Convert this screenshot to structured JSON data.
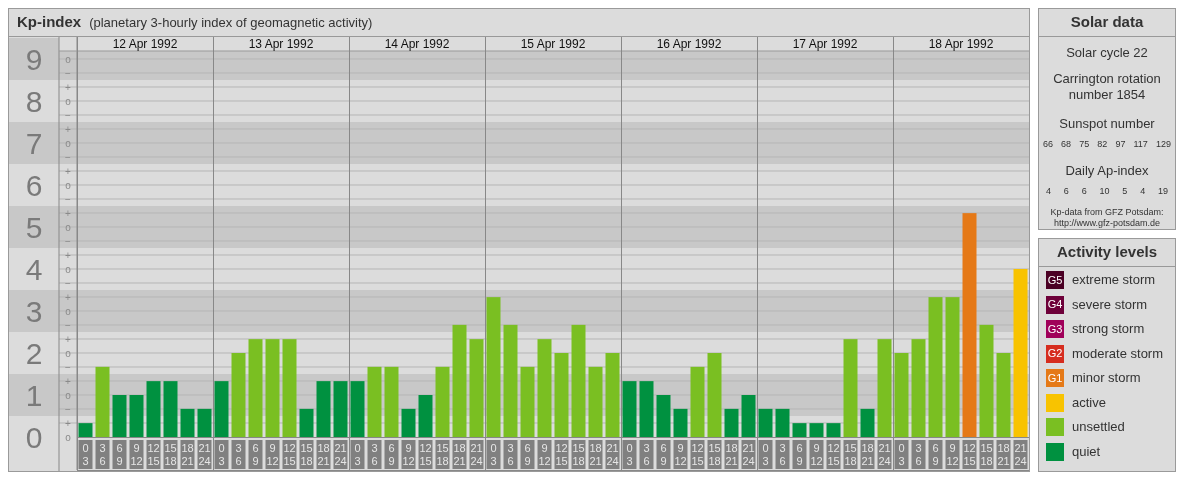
{
  "kp_panel": {
    "title": "Kp-index",
    "subtitle": "(planetary 3-hourly index of geomagnetic activity)",
    "days": [
      "12 Apr 1992",
      "13 Apr 1992",
      "14 Apr 1992",
      "15 Apr 1992",
      "16 Apr 1992",
      "17 Apr 1992",
      "18 Apr 1992"
    ],
    "minor_ticks": [
      "o",
      "−",
      "+",
      "o",
      "−",
      "+",
      "o",
      "−",
      "+",
      "o",
      "−",
      "+",
      "o",
      "−",
      "+",
      "o",
      "−",
      "+",
      "o",
      "−",
      "+",
      "o",
      "−",
      "+",
      "o",
      "−",
      "+",
      "o"
    ],
    "chart_data": {
      "type": "bar",
      "ylim": [
        0,
        9
      ],
      "yticks": [
        0,
        1,
        2,
        3,
        4,
        5,
        6,
        7,
        8,
        9
      ],
      "grid": true,
      "categories": [
        "0 3",
        "3 6",
        "6 9",
        "9 12",
        "12 15",
        "15 18",
        "18 21",
        "21 24",
        "0 3",
        "3 6",
        "6 9",
        "9 12",
        "12 15",
        "15 18",
        "18 21",
        "21 24",
        "0 3",
        "3 6",
        "6 9",
        "9 12",
        "12 15",
        "15 18",
        "18 21",
        "21 24",
        "0 3",
        "3 6",
        "6 9",
        "9 12",
        "12 15",
        "15 18",
        "18 21",
        "21 24",
        "0 3",
        "3 6",
        "6 9",
        "9 12",
        "12 15",
        "15 18",
        "18 21",
        "21 24",
        "0 3",
        "3 6",
        "6 9",
        "9 12",
        "12 15",
        "15 18",
        "18 21",
        "21 24",
        "0 3",
        "3 6",
        "6 9",
        "9 12",
        "12 15",
        "15 18",
        "18 21",
        "21 24"
      ],
      "series": [
        {
          "values": [
            0.33,
            1.67,
            1,
            1,
            1.33,
            1.33,
            0.67,
            0.67,
            1.33,
            2,
            2.33,
            2.33,
            2.33,
            0.67,
            1.33,
            1.33,
            1.33,
            1.67,
            1.67,
            0.67,
            1,
            1.67,
            2.67,
            2.33,
            3.33,
            2.67,
            1.67,
            2.33,
            2,
            2.67,
            1.67,
            2,
            1.33,
            1.33,
            1,
            0.67,
            1.67,
            2,
            0.67,
            1,
            0.67,
            0.67,
            0.33,
            0.33,
            0.33,
            2.33,
            0.67,
            2.33,
            2,
            2.33,
            3.33,
            3.33,
            5.33,
            2.67,
            2,
            4
          ]
        }
      ]
    }
  },
  "solar": {
    "title": "Solar data",
    "cycle": "Solar cycle 22",
    "carrington": "Carrington rotation number 1854",
    "sunspot_title": "Sunspot number",
    "sunspot_numbers": [
      "66",
      "68",
      "75",
      "82",
      "97",
      "117",
      "129"
    ],
    "ap_title": "Daily Ap-index",
    "ap_values": [
      "4",
      "6",
      "6",
      "10",
      "5",
      "4",
      "19"
    ],
    "credit": "Kp-data from GFZ Potsdam:",
    "credit_url": "http://www.gfz-potsdam.de"
  },
  "legend": {
    "title": "Activity levels",
    "items": [
      {
        "code": "G5",
        "label": "extreme storm",
        "color": "#4b0024"
      },
      {
        "code": "G4",
        "label": "severe storm",
        "color": "#6d0039"
      },
      {
        "code": "G3",
        "label": "strong storm",
        "color": "#a0005a"
      },
      {
        "code": "G2",
        "label": "moderate storm",
        "color": "#d62d1f"
      },
      {
        "code": "G1",
        "label": "minor storm",
        "color": "#e57917"
      },
      {
        "label": "active",
        "color": "#f8c300"
      },
      {
        "label": "unsettled",
        "color": "#7abf22"
      },
      {
        "label": "quiet",
        "color": "#009140"
      }
    ]
  }
}
